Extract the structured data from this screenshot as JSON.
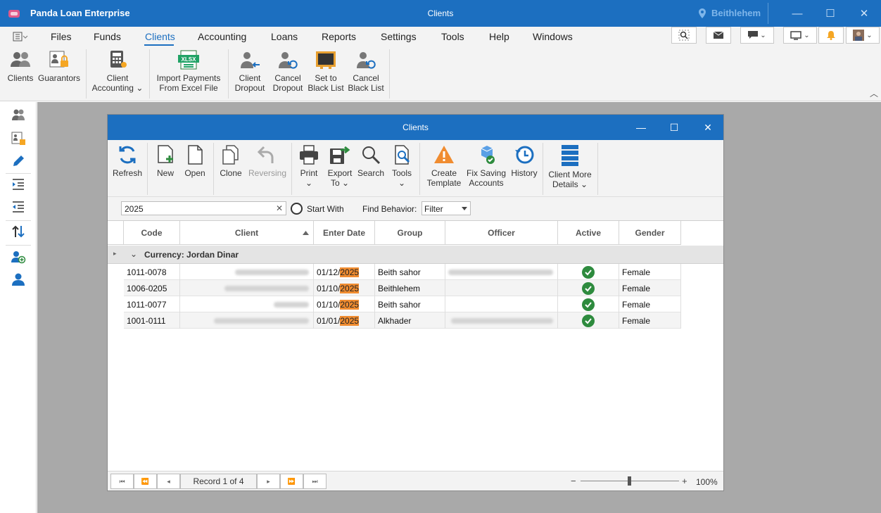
{
  "app": {
    "title": "Panda Loan Enterprise",
    "window_title": "Clients",
    "location": "Beithlehem"
  },
  "menu": [
    "Files",
    "Funds",
    "Clients",
    "Accounting",
    "Loans",
    "Reports",
    "Settings",
    "Tools",
    "Help",
    "Windows"
  ],
  "ribbon": {
    "clients": "Clients",
    "guarantors": "Guarantors",
    "client_accounting_1": "Client",
    "client_accounting_2": "Accounting",
    "import_1": "Import Payments",
    "import_2": "From Excel File",
    "client_dropout_1": "Client",
    "client_dropout_2": "Dropout",
    "cancel_dropout_1": "Cancel",
    "cancel_dropout_2": "Dropout",
    "set_black_1": "Set to",
    "set_black_2": "Black List",
    "cancel_black_1": "Cancel",
    "cancel_black_2": "Black List",
    "xlsx_badge": "XLSX"
  },
  "dialog": {
    "title": "Clients",
    "toolbar": {
      "refresh": "Refresh",
      "new": "New",
      "open": "Open",
      "clone": "Clone",
      "reversing": "Reversing",
      "print": "Print",
      "export_1": "Export",
      "export_2": "To",
      "search": "Search",
      "tools": "Tools",
      "create_template_1": "Create",
      "create_template_2": "Template",
      "fix_saving_1": "Fix Saving",
      "fix_saving_2": "Accounts",
      "history": "History",
      "client_more_1": "Client More",
      "client_more_2": "Details"
    },
    "find": {
      "value": "2025",
      "start_with": "Start With",
      "behavior_label": "Find Behavior:",
      "behavior_value": "Filter"
    },
    "columns": [
      "Code",
      "Client",
      "Enter Date",
      "Group",
      "Officer",
      "Active",
      "Gender"
    ],
    "group_label": "Currency: Jordan Dinar",
    "rows": [
      {
        "code": "1011-0078",
        "date_prefix": "01/12/",
        "date_year": "2025",
        "group": "Beith sahor",
        "active": true,
        "gender": "Female"
      },
      {
        "code": "1006-0205",
        "date_prefix": "01/10/",
        "date_year": "2025",
        "group": "Beithlehem",
        "active": true,
        "gender": "Female"
      },
      {
        "code": "1011-0077",
        "date_prefix": "01/10/",
        "date_year": "2025",
        "group": "Beith sahor",
        "active": true,
        "gender": "Female"
      },
      {
        "code": "1001-0111",
        "date_prefix": "01/01/",
        "date_year": "2025",
        "group": "Alkhader",
        "active": true,
        "gender": "Female"
      }
    ],
    "record_text": "Record 1 of 4",
    "zoom": "100%"
  },
  "colors": {
    "accent": "#1c6fc0",
    "highlight": "#f08c30",
    "active_check": "#2e8b3e"
  }
}
